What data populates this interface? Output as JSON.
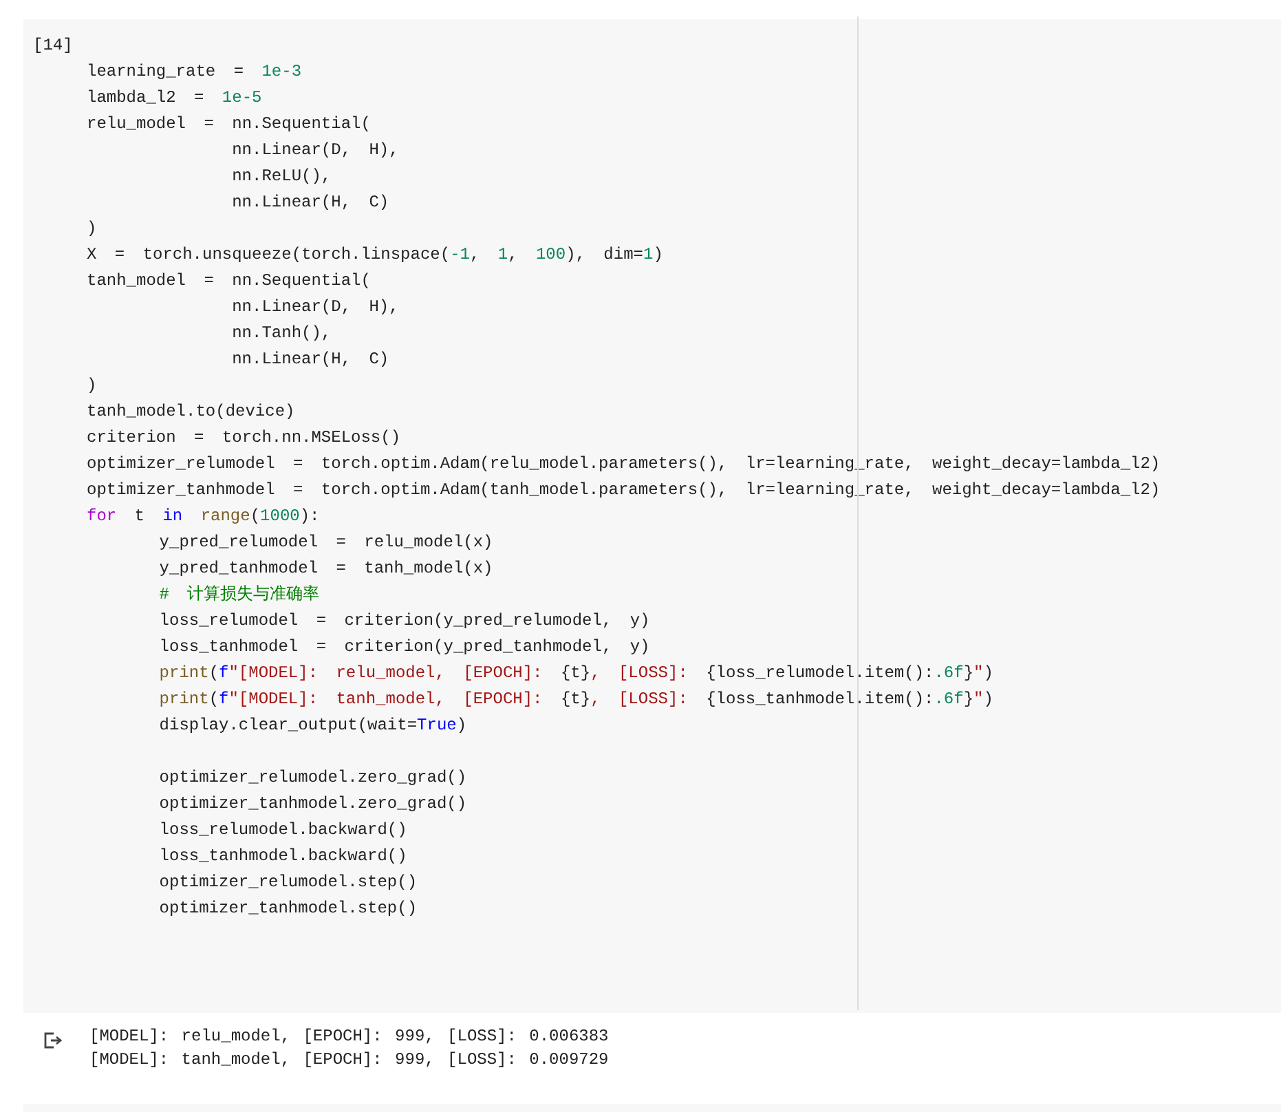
{
  "cell": {
    "prompt": "[14]",
    "lines": [
      {
        "kind": "code",
        "tokens": [
          {
            "kind": "plain",
            "text": "learning_rate = "
          },
          {
            "kind": "number",
            "text": "1e-3"
          }
        ]
      },
      {
        "kind": "code",
        "tokens": [
          {
            "kind": "plain",
            "text": "lambda_l2 = "
          },
          {
            "kind": "number",
            "text": "1e-5"
          }
        ]
      },
      {
        "kind": "code",
        "tokens": [
          {
            "kind": "plain",
            "text": "relu_model = nn.Sequential("
          }
        ]
      },
      {
        "kind": "code",
        "tokens": [
          {
            "kind": "plain",
            "text": "        nn.Linear(D, H),"
          }
        ]
      },
      {
        "kind": "code",
        "tokens": [
          {
            "kind": "plain",
            "text": "        nn.ReLU(),"
          }
        ]
      },
      {
        "kind": "code",
        "tokens": [
          {
            "kind": "plain",
            "text": "        nn.Linear(H, C)"
          }
        ]
      },
      {
        "kind": "code",
        "tokens": [
          {
            "kind": "plain",
            "text": ")"
          }
        ]
      },
      {
        "kind": "code",
        "tokens": [
          {
            "kind": "plain",
            "text": "X = torch.unsqueeze(torch.linspace("
          },
          {
            "kind": "number",
            "text": "-1"
          },
          {
            "kind": "plain",
            "text": ", "
          },
          {
            "kind": "number",
            "text": "1"
          },
          {
            "kind": "plain",
            "text": ", "
          },
          {
            "kind": "number",
            "text": "100"
          },
          {
            "kind": "plain",
            "text": "), dim="
          },
          {
            "kind": "number",
            "text": "1"
          },
          {
            "kind": "plain",
            "text": ")"
          }
        ]
      },
      {
        "kind": "code",
        "tokens": [
          {
            "kind": "plain",
            "text": "tanh_model = nn.Sequential("
          }
        ]
      },
      {
        "kind": "code",
        "tokens": [
          {
            "kind": "plain",
            "text": "        nn.Linear(D, H),"
          }
        ]
      },
      {
        "kind": "code",
        "tokens": [
          {
            "kind": "plain",
            "text": "        nn.Tanh(),"
          }
        ]
      },
      {
        "kind": "code",
        "tokens": [
          {
            "kind": "plain",
            "text": "        nn.Linear(H, C)"
          }
        ]
      },
      {
        "kind": "code",
        "tokens": [
          {
            "kind": "plain",
            "text": ")"
          }
        ]
      },
      {
        "kind": "code",
        "tokens": [
          {
            "kind": "plain",
            "text": "tanh_model.to(device)"
          }
        ]
      },
      {
        "kind": "code",
        "tokens": [
          {
            "kind": "plain",
            "text": "criterion = torch.nn.MSELoss()"
          }
        ]
      },
      {
        "kind": "code",
        "tokens": [
          {
            "kind": "plain",
            "text": "optimizer_relumodel = torch.optim.Adam(relu_model.parameters(), lr=learning_rate, weight_decay=lambda_l2)"
          }
        ]
      },
      {
        "kind": "code",
        "tokens": [
          {
            "kind": "plain",
            "text": "optimizer_tanhmodel = torch.optim.Adam(tanh_model.parameters(), lr=learning_rate, weight_decay=lambda_l2)"
          }
        ]
      },
      {
        "kind": "code",
        "tokens": [
          {
            "kind": "keyword",
            "text": "for"
          },
          {
            "kind": "plain",
            "text": " t "
          },
          {
            "kind": "constant",
            "text": "in"
          },
          {
            "kind": "builtin",
            "text": " range"
          },
          {
            "kind": "plain",
            "text": "("
          },
          {
            "kind": "number",
            "text": "1000"
          },
          {
            "kind": "plain",
            "text": "):"
          }
        ]
      },
      {
        "kind": "code",
        "tokens": [
          {
            "kind": "plain",
            "text": "    y_pred_relumodel = relu_model(x)"
          }
        ]
      },
      {
        "kind": "code",
        "tokens": [
          {
            "kind": "plain",
            "text": "    y_pred_tanhmodel = tanh_model(x)"
          }
        ]
      },
      {
        "kind": "code",
        "tokens": [
          {
            "kind": "comment",
            "text": "    # 计算损失与准确率"
          }
        ]
      },
      {
        "kind": "code",
        "tokens": [
          {
            "kind": "plain",
            "text": "    loss_relumodel = criterion(y_pred_relumodel, y)"
          }
        ]
      },
      {
        "kind": "code",
        "tokens": [
          {
            "kind": "plain",
            "text": "    loss_tanhmodel = criterion(y_pred_tanhmodel, y)"
          }
        ]
      },
      {
        "kind": "code",
        "tokens": [
          {
            "kind": "builtin",
            "text": "    print"
          },
          {
            "kind": "plain",
            "text": "("
          },
          {
            "kind": "constant",
            "text": "f"
          },
          {
            "kind": "string",
            "text": "\"[MODEL]: relu_model, [EPOCH]: "
          },
          {
            "kind": "plain",
            "text": "{t}"
          },
          {
            "kind": "string",
            "text": ", [LOSS]: "
          },
          {
            "kind": "plain",
            "text": "{loss_relumodel.item():"
          },
          {
            "kind": "number",
            "text": ".6f"
          },
          {
            "kind": "plain",
            "text": "}"
          },
          {
            "kind": "string",
            "text": "\""
          },
          {
            "kind": "plain",
            "text": ")"
          }
        ]
      },
      {
        "kind": "code",
        "tokens": [
          {
            "kind": "builtin",
            "text": "    print"
          },
          {
            "kind": "plain",
            "text": "("
          },
          {
            "kind": "constant",
            "text": "f"
          },
          {
            "kind": "string",
            "text": "\"[MODEL]: tanh_model, [EPOCH]: "
          },
          {
            "kind": "plain",
            "text": "{t}"
          },
          {
            "kind": "string",
            "text": ", [LOSS]: "
          },
          {
            "kind": "plain",
            "text": "{loss_tanhmodel.item():"
          },
          {
            "kind": "number",
            "text": ".6f"
          },
          {
            "kind": "plain",
            "text": "}"
          },
          {
            "kind": "string",
            "text": "\""
          },
          {
            "kind": "plain",
            "text": ")"
          }
        ]
      },
      {
        "kind": "code",
        "tokens": [
          {
            "kind": "plain",
            "text": "    display.clear_output(wait="
          },
          {
            "kind": "constant",
            "text": "True"
          },
          {
            "kind": "plain",
            "text": ")"
          }
        ]
      },
      {
        "kind": "blank"
      },
      {
        "kind": "code",
        "tokens": [
          {
            "kind": "plain",
            "text": "    optimizer_relumodel.zero_grad()"
          }
        ]
      },
      {
        "kind": "code",
        "tokens": [
          {
            "kind": "plain",
            "text": "    optimizer_tanhmodel.zero_grad()"
          }
        ]
      },
      {
        "kind": "code",
        "tokens": [
          {
            "kind": "plain",
            "text": "    loss_relumodel.backward()"
          }
        ]
      },
      {
        "kind": "code",
        "tokens": [
          {
            "kind": "plain",
            "text": "    loss_tanhmodel.backward()"
          }
        ]
      },
      {
        "kind": "code",
        "tokens": [
          {
            "kind": "plain",
            "text": "    optimizer_relumodel.step()"
          }
        ]
      },
      {
        "kind": "code",
        "tokens": [
          {
            "kind": "plain",
            "text": "    optimizer_tanhmodel.step()"
          }
        ]
      }
    ],
    "output_lines": [
      "[MODEL]: relu_model, [EPOCH]: 999, [LOSS]: 0.006383",
      "[MODEL]: tanh_model, [EPOCH]: 999, [LOSS]: 0.009729"
    ]
  }
}
